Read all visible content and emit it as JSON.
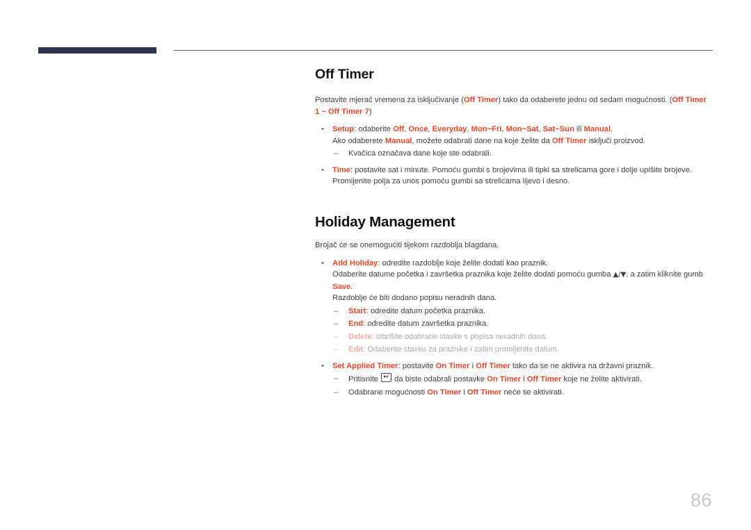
{
  "page": {
    "number": "86"
  },
  "sections": [
    {
      "heading": "Off Timer",
      "intro": {
        "seg1": "Postavite mjerač vremena za isključivanje (",
        "acc1": "Off Timer",
        "seg2": ") tako da odaberete jednu od sedam mogućnosti. (",
        "acc2": "Off Timer 1 ~ Off Timer 7",
        "seg3": ")"
      },
      "setup": {
        "label": "Setup",
        "seg1": ": odaberite ",
        "opt1": "Off",
        "sep1": ", ",
        "opt2": "Once",
        "sep2": ", ",
        "opt3": "Everyday",
        "sep3": ", ",
        "opt4": "Mon~Fri",
        "sep4": ", ",
        "opt5": "Mon~Sat",
        "sep5": ", ",
        "opt6": "Sat~Sun",
        "sep6": " ili ",
        "opt7": "Manual",
        "seg2": ".",
        "line2_a": "Ako odaberete ",
        "line2_acc1": "Manual",
        "line2_b": ", možete odabrati dane na koje želite da ",
        "line2_acc2": "Off Timer",
        "line2_c": " isključi proizvod.",
        "sub1": "Kvačica označava dane koje ste odabrali."
      },
      "time": {
        "label": "Time",
        "text": ": postavite sat i minute. Pomoću gumbi s brojevima ili tipki sa strelicama gore i dolje upišite brojeve. Promijenite polja za unos pomoću gumbi sa strelicama lijevo i desno."
      }
    },
    {
      "heading": "Holiday Management",
      "intro": "Brojač će se onemogućiti tijekom razdoblja blagdana.",
      "add_holiday": {
        "label": "Add Holiday",
        "seg1": ": odredite razdoblje koje želite dodati kao praznik.",
        "line2_a": "Odaberite datume početka i završetka praznika koje želite dodati pomoću gumba ",
        "line2_glyph": "▲/▼",
        "line2_b": ", a zatim kliknite gumb ",
        "line2_acc": "Save",
        "line2_c": ".",
        "line3": "Razdoblje će biti dodano popisu neradnih dana.",
        "start": {
          "label": "Start",
          "text": ": odredite datum početka praznika."
        },
        "end": {
          "label": "End",
          "text": ": odredite datum završetka praznika."
        },
        "delete": {
          "label": "Delete",
          "text": ": izbrišite odabrane stavke s popisa neradnih dana."
        },
        "edit": {
          "label": "Edit",
          "text": ": Odaberite stavku za praznike i zatim promijenite datum."
        }
      },
      "set_applied_timer": {
        "label": "Set Applied Timer",
        "seg1": ": postavite ",
        "acc1": "On Timer",
        "seg2": " i ",
        "acc2": "Off Timer",
        "seg3": " tako da se ne aktivira na državni praznik.",
        "sub1": {
          "a": "Pritisnite ",
          "icon": "enter-key-icon",
          "b": " da biste odabrali postavke ",
          "acc1": "On Timer",
          "c": " i ",
          "acc2": "Off Timer",
          "d": " koje ne želite aktivirati."
        },
        "sub2": {
          "a": "Odabrane mogućnosti ",
          "acc1": "On Timer",
          "b": " i ",
          "acc2": "Off Timer",
          "c": " neće se aktivirati."
        }
      }
    }
  ]
}
